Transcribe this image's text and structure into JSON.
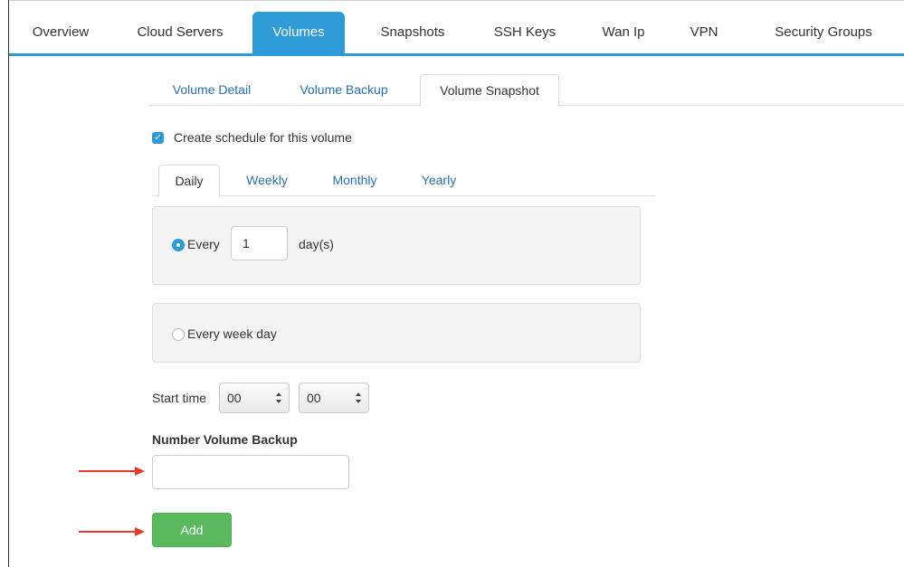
{
  "top_tabs": [
    {
      "label": "Overview",
      "active": false
    },
    {
      "label": "Cloud Servers",
      "active": false
    },
    {
      "label": "Volumes",
      "active": true
    },
    {
      "label": "Snapshots",
      "active": false
    },
    {
      "label": "SSH Keys",
      "active": false
    },
    {
      "label": "Wan Ip",
      "active": false
    },
    {
      "label": "VPN",
      "active": false
    },
    {
      "label": "Security Groups",
      "active": false
    }
  ],
  "sub_tabs": [
    {
      "label": "Volume Detail",
      "active": false
    },
    {
      "label": "Volume Backup",
      "active": false
    },
    {
      "label": "Volume Snapshot",
      "active": true
    }
  ],
  "schedule": {
    "checkbox_label": "Create schedule for this volume",
    "checked": true
  },
  "frequency_tabs": [
    {
      "label": "Daily",
      "active": true
    },
    {
      "label": "Weekly",
      "active": false
    },
    {
      "label": "Monthly",
      "active": false
    },
    {
      "label": "Yearly",
      "active": false
    }
  ],
  "daily": {
    "every_label": "Every",
    "every_value": "1",
    "unit_label": "day(s)",
    "weekday_label": "Every week day",
    "selected_option": "every"
  },
  "start_time": {
    "label": "Start time",
    "hour": "00",
    "minute": "00"
  },
  "number_backup": {
    "label": "Number Volume Backup",
    "value": ""
  },
  "add_button": {
    "label": "Add"
  },
  "colors": {
    "accent": "#2e9bd6",
    "link": "#2a6fb0",
    "add_button": "#5cb85c",
    "annotation_arrow": "#e53b2c"
  }
}
